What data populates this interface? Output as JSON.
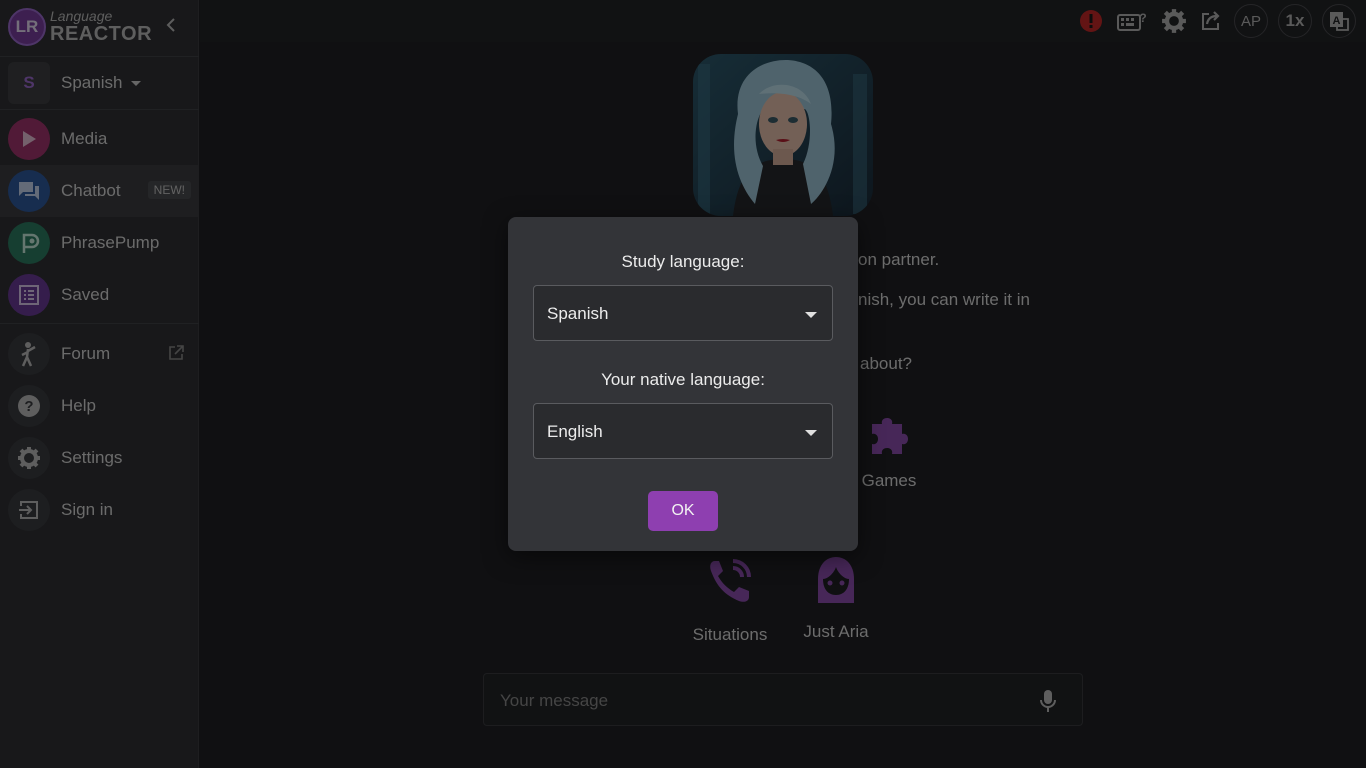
{
  "app": {
    "logo_top": "Language",
    "logo_bottom": "REACTOR",
    "logo_mark": "LR"
  },
  "language_selector": {
    "letter": "S",
    "label": "Spanish"
  },
  "nav": {
    "media": "Media",
    "chatbot": "Chatbot",
    "chatbot_badge": "NEW!",
    "phrasepump": "PhrasePump",
    "saved": "Saved",
    "forum": "Forum",
    "help": "Help",
    "settings": "Settings",
    "signin": "Sign in"
  },
  "toolbar": {
    "profile": "AP",
    "speed": "1x"
  },
  "chat": {
    "intro_line1": "on partner.",
    "intro_line2": "nish, you can write it in",
    "intro_line3": "about?",
    "options": {
      "games": "Games",
      "situations": "Situations",
      "just_aria": "Just Aria"
    },
    "message_placeholder": "Your message"
  },
  "dialog": {
    "study_label": "Study language:",
    "study_value": "Spanish",
    "native_label": "Your native language:",
    "native_value": "English",
    "ok": "OK"
  },
  "colors": {
    "accent": "#8e3fb0",
    "alert": "#c62828",
    "sidebar_bg": "#303134",
    "main_bg": "#202124"
  }
}
